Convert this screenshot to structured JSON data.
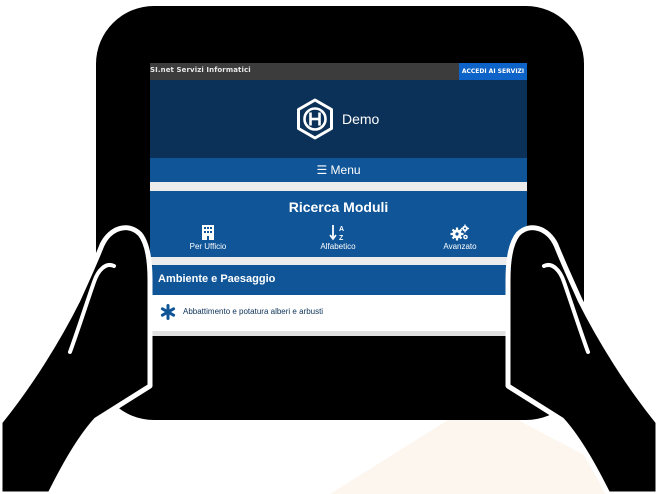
{
  "site": {
    "brand_text": "SI.net Servizi Informatici",
    "access_button": "ACCEDI AI SERVIZI",
    "logo_text": "Demo"
  },
  "menu": {
    "label": "☰ Menu"
  },
  "search": {
    "title": "Ricerca Moduli",
    "options": [
      {
        "label": "Per Ufficio",
        "icon": "building-icon"
      },
      {
        "label": "Alfabetico",
        "icon": "sort-alpha-icon"
      },
      {
        "label": "Avanzato",
        "icon": "gears-icon"
      }
    ]
  },
  "category": {
    "title": "Ambiente e Paesaggio",
    "items": [
      {
        "label": "Abbattimento e potatura alberi e arbusti",
        "icon": "asterisk-icon"
      }
    ]
  },
  "colors": {
    "header_dark": "#0b3158",
    "primary_blue": "#0f5597",
    "access_blue": "#0d63c7",
    "background_shape": "#fdf6ee"
  }
}
